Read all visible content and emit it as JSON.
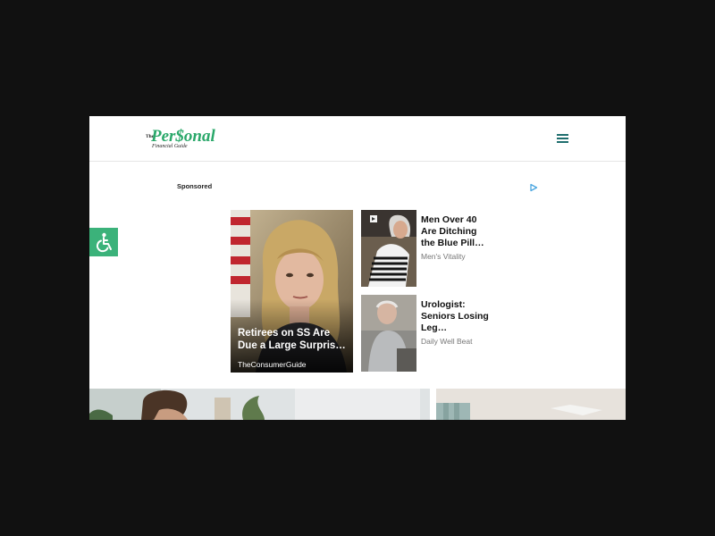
{
  "header": {
    "logo_small": "The",
    "logo_main": "Per$onal",
    "logo_sub": "Financial Guide",
    "menu_icon": "hamburger-menu-icon"
  },
  "accessibility": {
    "icon": "wheelchair-icon"
  },
  "ads": {
    "sponsored_label": "Sponsored",
    "adchoices_icon": "adchoices-play-icon",
    "main": {
      "title": "Retirees on SS Are Due a Large Surpris…",
      "source": "TheConsumerGuide"
    },
    "side": [
      {
        "title": "Men Over 40 Are Ditching the Blue Pill…",
        "source": "Men's Vitality"
      },
      {
        "title": "Urologist: Seniors Losing Leg…",
        "source": "Daily Well Beat"
      }
    ]
  },
  "colors": {
    "brand_green": "#2aa86a",
    "menu_teal": "#1f6e6e",
    "accessibility_green": "#3bb27a"
  }
}
